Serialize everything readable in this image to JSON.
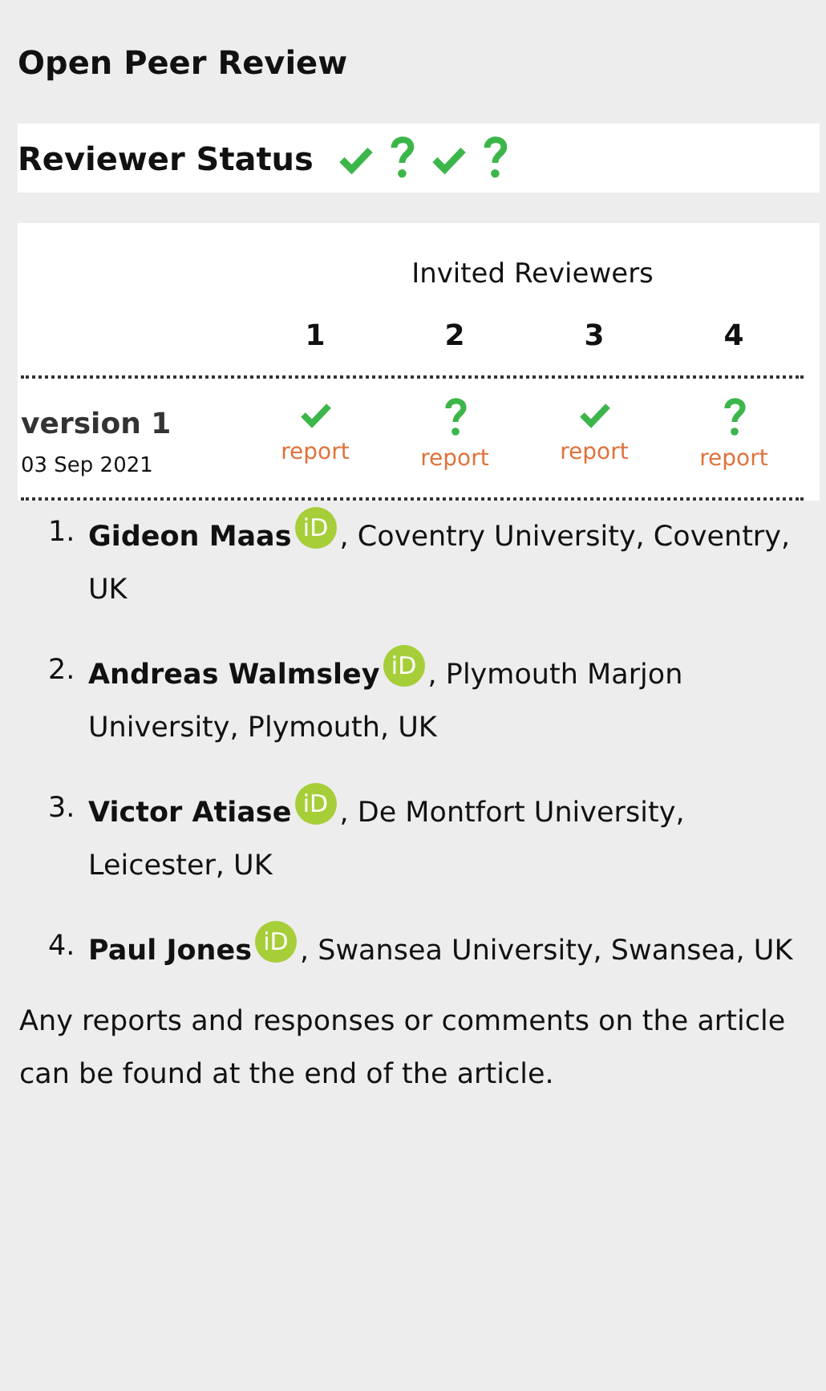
{
  "title": "Open Peer Review",
  "reviewer_status": {
    "label": "Reviewer Status",
    "statuses": [
      {
        "kind": "approved"
      },
      {
        "kind": "reservations"
      },
      {
        "kind": "approved"
      },
      {
        "kind": "reservations"
      }
    ]
  },
  "table": {
    "header": "Invited Reviewers",
    "columns": [
      "1",
      "2",
      "3",
      "4"
    ],
    "rows": [
      {
        "version": "version 1",
        "date": "03 Sep 2021",
        "cells": [
          {
            "kind": "approved",
            "link": "report"
          },
          {
            "kind": "reservations",
            "link": "report"
          },
          {
            "kind": "approved",
            "link": "report"
          },
          {
            "kind": "reservations",
            "link": "report"
          }
        ]
      }
    ]
  },
  "reviewers": [
    {
      "number": "1.",
      "name": "Gideon Maas",
      "orcid": "iD",
      "affiliation": ", Coventry University, Coventry, UK"
    },
    {
      "number": "2.",
      "name": "Andreas Walmsley",
      "orcid": "iD",
      "affiliation": ", Plymouth Marjon University, Plymouth, UK"
    },
    {
      "number": "3.",
      "name": "Victor Atiase",
      "orcid": "iD",
      "affiliation": ", De Montfort University, Leicester, UK"
    },
    {
      "number": "4.",
      "name": "Paul Jones",
      "orcid": "iD",
      "affiliation": ", Swansea University, Swansea, UK"
    }
  ],
  "footer": "Any reports and responses or comments on the article can be found at the end of the article."
}
